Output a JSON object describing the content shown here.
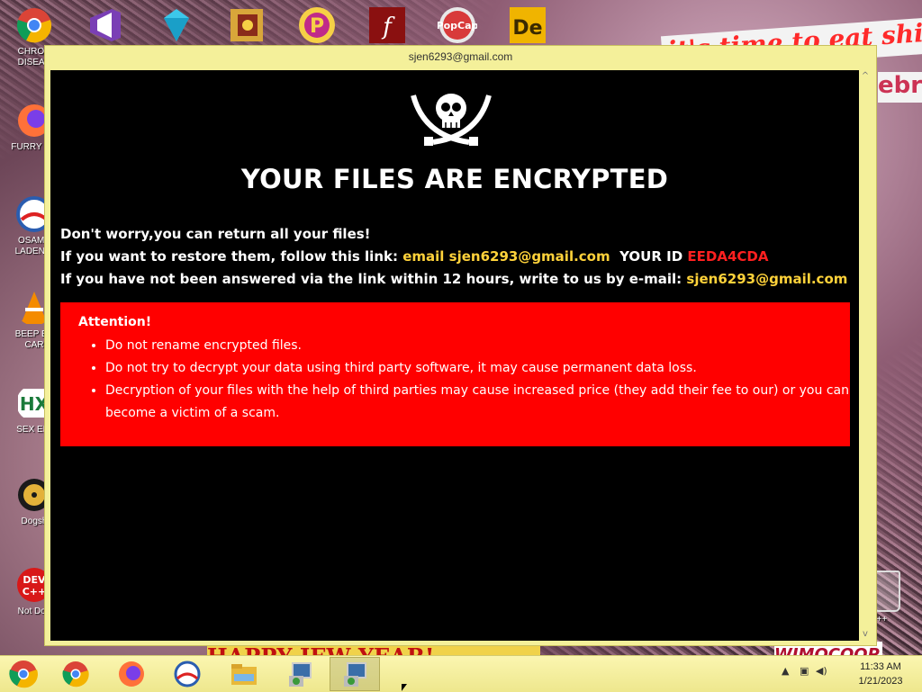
{
  "window": {
    "title": "sjen6293@gmail.com",
    "headline": "YOUR FILES ARE ENCRYPTED",
    "line1": "Don't worry,you can return all your files!",
    "line2_prefix": "If you want to restore them, follow this link:",
    "line2_email": "email sjen6293@gmail.com",
    "line2_id_label": "YOUR ID",
    "line2_id": "EEDA4CDA",
    "line3_prefix": "If you have not been answered via the link within 12 hours, write to us by e-mail:",
    "line3_email": "sjen6293@gmail.com",
    "attention_title": "Attention!",
    "attention_items": [
      "Do not rename encrypted files.",
      "Do not try to decrypt your data using third party software, it may cause permanent data loss.",
      "Decryption of your files with the help of third parties may cause increased price (they add their fee to our) or you can become a victim of a scam."
    ],
    "colors": {
      "email": "#ffd23a",
      "id": "#ff2020",
      "attention_bg": "#ff0000"
    }
  },
  "desktop": {
    "icons": [
      {
        "label": "CHRON\nDISEAS",
        "icon": "chrome-icon"
      },
      {
        "label": "FURRY CU",
        "icon": "firefox-icon"
      },
      {
        "label": "OSAMA\nLADEN B",
        "icon": "obama-logo-icon"
      },
      {
        "label": "BEEP BE\nCAR",
        "icon": "vlc-cone-icon"
      },
      {
        "label": "SEX EDI",
        "icon": "hxd-icon"
      },
      {
        "label": "Dogsh",
        "icon": "gold-disc-icon"
      },
      {
        "label": "Not Dog",
        "icon": "devcpp-icon"
      }
    ],
    "top_icons": [
      "visual-studio-icon",
      "gem-icon",
      "book-icon",
      "p-icon",
      "flash-icon",
      "popcap-icon",
      "de-icon"
    ],
    "wallpaper_text_top": "it's time to eat shit",
    "wallpaper_text_2": "ebra",
    "wallpaper_text_bottom": "HAPPY JEW YEAR!",
    "wallpaper_text_bottom_right": "WIMOCOOP",
    "recycle_label": "n C++"
  },
  "taskbar": {
    "time": "11:33 AM",
    "date": "1/21/2023"
  }
}
